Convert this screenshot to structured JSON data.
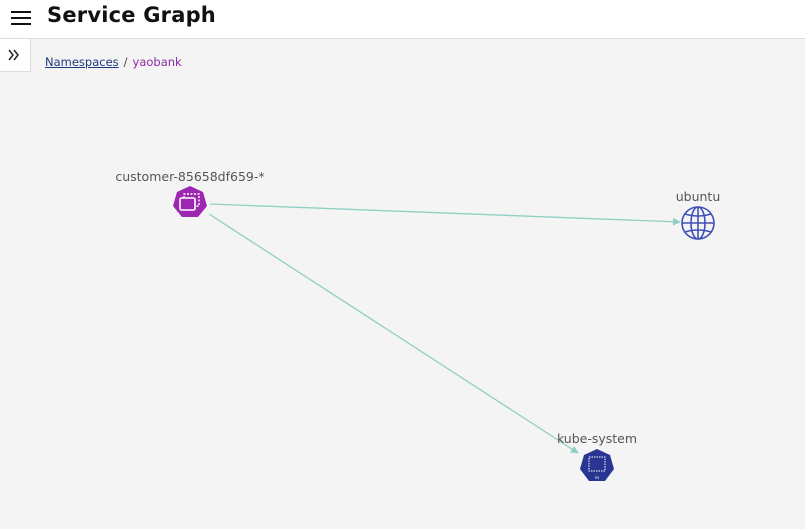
{
  "header": {
    "title": "Service Graph",
    "menu_icon": "hamburger-icon"
  },
  "sidebar": {
    "toggle_icon": "double-chevron-right-icon"
  },
  "breadcrumb": {
    "items": [
      "Namespaces",
      "yaobank"
    ],
    "separator": "/"
  },
  "graph": {
    "nodes": [
      {
        "label": "customer-85658df659-*",
        "type": "pod",
        "icon": "pod-icon",
        "color": "#9c27b0"
      },
      {
        "label": "ubuntu",
        "type": "network",
        "icon": "globe-icon",
        "color": "#3f51b5"
      },
      {
        "label": "kube-system",
        "type": "namespace",
        "icon": "namespace-icon",
        "color": "#283593"
      }
    ],
    "edges": [
      {
        "from": "customer-85658df659-*",
        "to": "ubuntu"
      },
      {
        "from": "customer-85658df659-*",
        "to": "kube-system"
      }
    ],
    "edge_color": "#8fd0c4"
  }
}
